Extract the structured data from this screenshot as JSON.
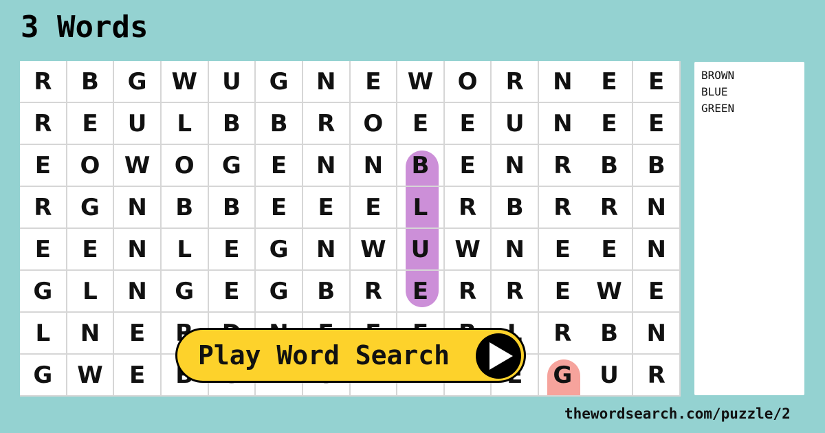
{
  "title": "3 Words",
  "grid": [
    [
      "R",
      "B",
      "G",
      "W",
      "U",
      "G",
      "N",
      "E",
      "W",
      "O",
      "R",
      "N",
      "E",
      "E"
    ],
    [
      "R",
      "E",
      "U",
      "L",
      "B",
      "B",
      "R",
      "O",
      "E",
      "E",
      "U",
      "N",
      "E",
      "E"
    ],
    [
      "E",
      "O",
      "W",
      "O",
      "G",
      "E",
      "N",
      "N",
      "B",
      "E",
      "N",
      "R",
      "B",
      "B"
    ],
    [
      "R",
      "G",
      "N",
      "B",
      "B",
      "E",
      "E",
      "E",
      "L",
      "R",
      "B",
      "R",
      "R",
      "N"
    ],
    [
      "E",
      "E",
      "N",
      "L",
      "E",
      "G",
      "N",
      "W",
      "U",
      "W",
      "N",
      "E",
      "E",
      "N"
    ],
    [
      "G",
      "L",
      "N",
      "G",
      "E",
      "G",
      "B",
      "R",
      "E",
      "R",
      "R",
      "E",
      "W",
      "E"
    ],
    [
      "L",
      "N",
      "E",
      "R",
      "D",
      "N",
      "E",
      "E",
      "E",
      "R",
      "L",
      "R",
      "B",
      "N"
    ],
    [
      "G",
      "W",
      "E",
      "B",
      "O",
      "E",
      "O",
      "N",
      "N",
      "R",
      "E",
      "G",
      "U",
      "R"
    ]
  ],
  "found_words": [
    {
      "word": "BLUE",
      "color": "#cc8fd8"
    },
    {
      "word": "GREEN",
      "color": "#f6a39c"
    }
  ],
  "word_list": [
    "BROWN",
    "BLUE",
    "GREEN"
  ],
  "play_button": {
    "label": "Play Word Search",
    "icon": "play-icon",
    "color": "#fdd22b"
  },
  "footer": {
    "url": "thewordsearch.com/puzzle/2"
  },
  "colors": {
    "background": "#94d2d1",
    "grid_bg": "#ffffff"
  }
}
